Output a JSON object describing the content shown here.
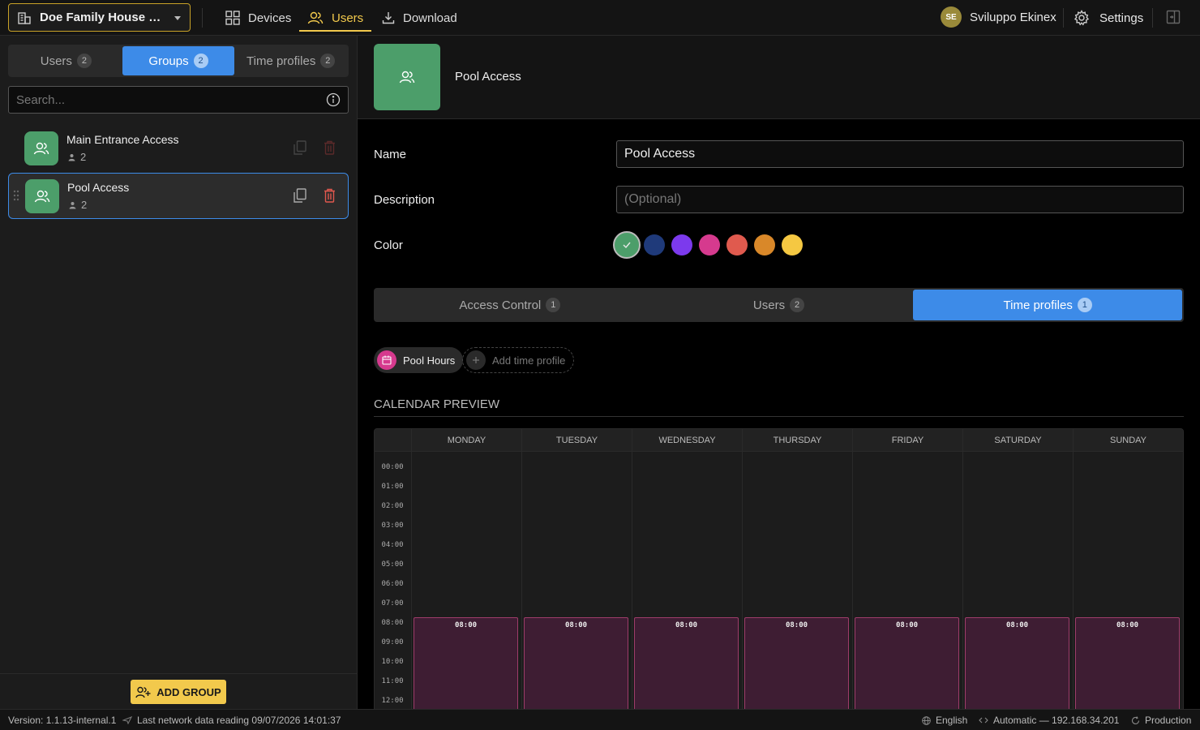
{
  "topbar": {
    "project_name": "Doe Family House Pro...",
    "nav": {
      "devices": "Devices",
      "users": "Users",
      "download": "Download"
    },
    "user": {
      "initials": "SE",
      "name": "Sviluppo Ekinex"
    },
    "settings": "Settings"
  },
  "left": {
    "tabs": [
      {
        "label": "Users",
        "count": "2"
      },
      {
        "label": "Groups",
        "count": "2"
      },
      {
        "label": "Time profiles",
        "count": "2"
      }
    ],
    "search_placeholder": "Search...",
    "groups": [
      {
        "name": "Main Entrance Access",
        "count": "2"
      },
      {
        "name": "Pool Access",
        "count": "2"
      }
    ],
    "add_group": "ADD GROUP"
  },
  "detail": {
    "title": "Pool Access",
    "name_label": "Name",
    "name_value": "Pool Access",
    "description_label": "Description",
    "description_placeholder": "(Optional)",
    "color_label": "Color",
    "colors": [
      "#4c9e6a",
      "#1f3a7a",
      "#7c3aed",
      "#d63a8e",
      "#e05a4e",
      "#d98829",
      "#f5c842"
    ],
    "selected_color": "#4c9e6a",
    "tabs": [
      {
        "label": "Access Control",
        "count": "1"
      },
      {
        "label": "Users",
        "count": "2"
      },
      {
        "label": "Time profiles",
        "count": "1"
      }
    ],
    "time_profile_chip": "Pool Hours",
    "time_profile_chip_color": "#d63a8e",
    "add_time_profile": "Add time profile",
    "calendar": {
      "title": "CALENDAR PREVIEW",
      "days": [
        "MONDAY",
        "TUESDAY",
        "WEDNESDAY",
        "THURSDAY",
        "FRIDAY",
        "SATURDAY",
        "SUNDAY"
      ],
      "hours": [
        "00:00",
        "01:00",
        "02:00",
        "03:00",
        "04:00",
        "05:00",
        "06:00",
        "07:00",
        "08:00",
        "09:00",
        "10:00",
        "11:00",
        "12:00"
      ],
      "block_start": "08:00",
      "block_start_hour": 8
    }
  },
  "status": {
    "version": "Version: 1.1.13-internal.1",
    "last_reading": "Last network data reading 09/07/2026 14:01:37",
    "language": "English",
    "connection": "Automatic — 192.168.34.201",
    "environment": "Production"
  }
}
